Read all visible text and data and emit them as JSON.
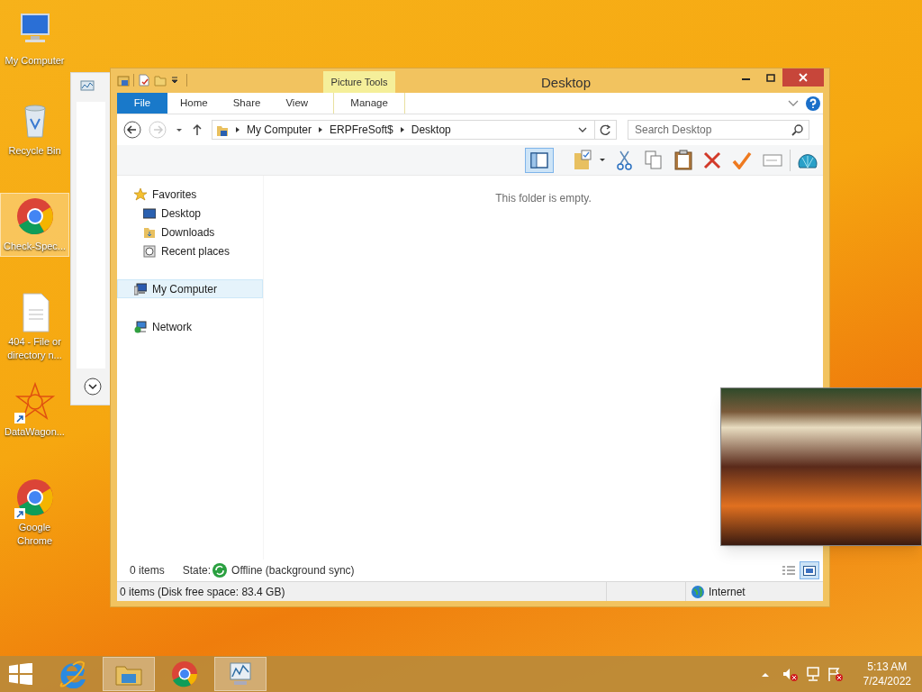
{
  "desktop_icons": [
    {
      "label": "My Computer",
      "kind": "computer",
      "selected": false,
      "shortcut": false
    },
    {
      "label": "Recycle Bin",
      "kind": "recycle",
      "selected": false,
      "shortcut": false
    },
    {
      "label": "Check-Spec...",
      "kind": "chrome",
      "selected": true,
      "shortcut": false
    },
    {
      "label": "404 - File or directory n...",
      "kind": "document",
      "selected": false,
      "shortcut": false
    },
    {
      "label": "DataWagon...",
      "kind": "star",
      "selected": false,
      "shortcut": true
    },
    {
      "label": "Google Chrome",
      "kind": "chrome",
      "selected": false,
      "shortcut": true
    }
  ],
  "explorer": {
    "title": "Desktop",
    "contextual_tab": "Picture Tools",
    "ribbon_tabs": [
      {
        "label": "File",
        "kind": "file"
      },
      {
        "label": "Home",
        "kind": "plain"
      },
      {
        "label": "Share",
        "kind": "plain"
      },
      {
        "label": "View",
        "kind": "plain"
      },
      {
        "label": "Manage",
        "kind": "contextual"
      }
    ],
    "breadcrumbs": [
      "My Computer",
      "ERPFreSoft$",
      "Desktop"
    ],
    "search": {
      "placeholder": "Search Desktop"
    },
    "nav_tree": [
      {
        "label": "Favorites",
        "kind": "star",
        "selected": false,
        "children": [
          {
            "label": "Desktop",
            "kind": "desktop",
            "selected": false
          },
          {
            "label": "Downloads",
            "kind": "folder",
            "selected": false
          },
          {
            "label": "Recent places",
            "kind": "recent",
            "selected": false
          }
        ]
      },
      {
        "label": "My Computer",
        "kind": "computer",
        "selected": true
      },
      {
        "label": "Network",
        "kind": "network",
        "selected": false
      }
    ],
    "empty_message": "This folder is empty.",
    "details": {
      "count": "0 items",
      "state_label": "State:",
      "state": "Offline (background sync)"
    },
    "status_bar": {
      "text": "0 items (Disk free space: 83.4 GB)",
      "zone": "Internet"
    }
  },
  "taskbar": {
    "apps": [
      {
        "kind": "ie",
        "active": false
      },
      {
        "kind": "explorer",
        "active": true
      },
      {
        "kind": "chrome",
        "active": false
      },
      {
        "kind": "monitor",
        "active": true
      }
    ],
    "time": "5:13 AM",
    "date": "7/24/2022"
  }
}
